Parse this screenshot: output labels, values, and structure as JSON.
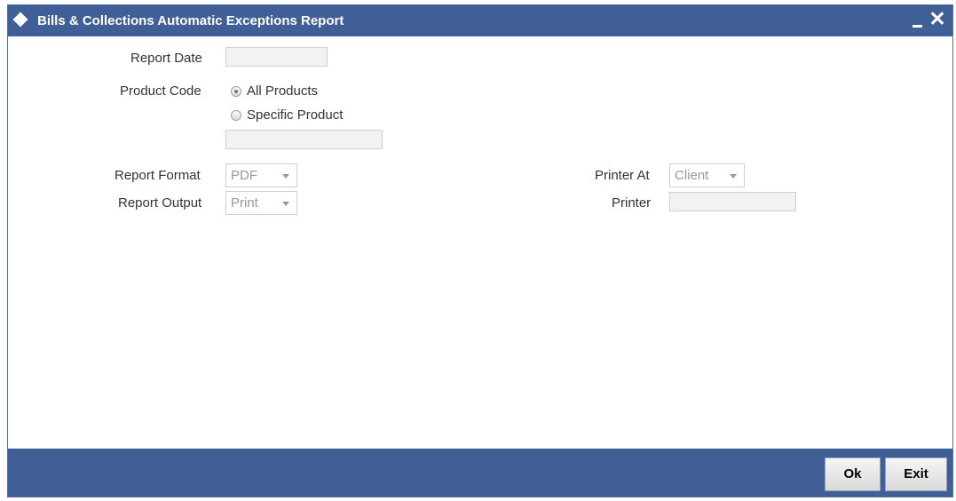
{
  "window": {
    "title": "Bills & Collections Automatic Exceptions Report",
    "minimize_icon": "minimize-icon",
    "close_icon": "close-icon",
    "close_glyph": "✕"
  },
  "form": {
    "report_date_label": "Report Date",
    "report_date_value": "",
    "product_code_label": "Product Code",
    "product_options": [
      {
        "label": "All Products",
        "checked": true
      },
      {
        "label": "Specific Product",
        "checked": false
      }
    ],
    "specific_product_value": "",
    "report_format_label": "Report Format",
    "report_format_value": "PDF",
    "report_output_label": "Report Output",
    "report_output_value": "Print",
    "printer_at_label": "Printer At",
    "printer_at_value": "Client",
    "printer_label": "Printer",
    "printer_value": ""
  },
  "footer": {
    "ok_label": "Ok",
    "exit_label": "Exit"
  },
  "colors": {
    "titlebar": "#3f5f96",
    "footer": "#3f5f96"
  }
}
